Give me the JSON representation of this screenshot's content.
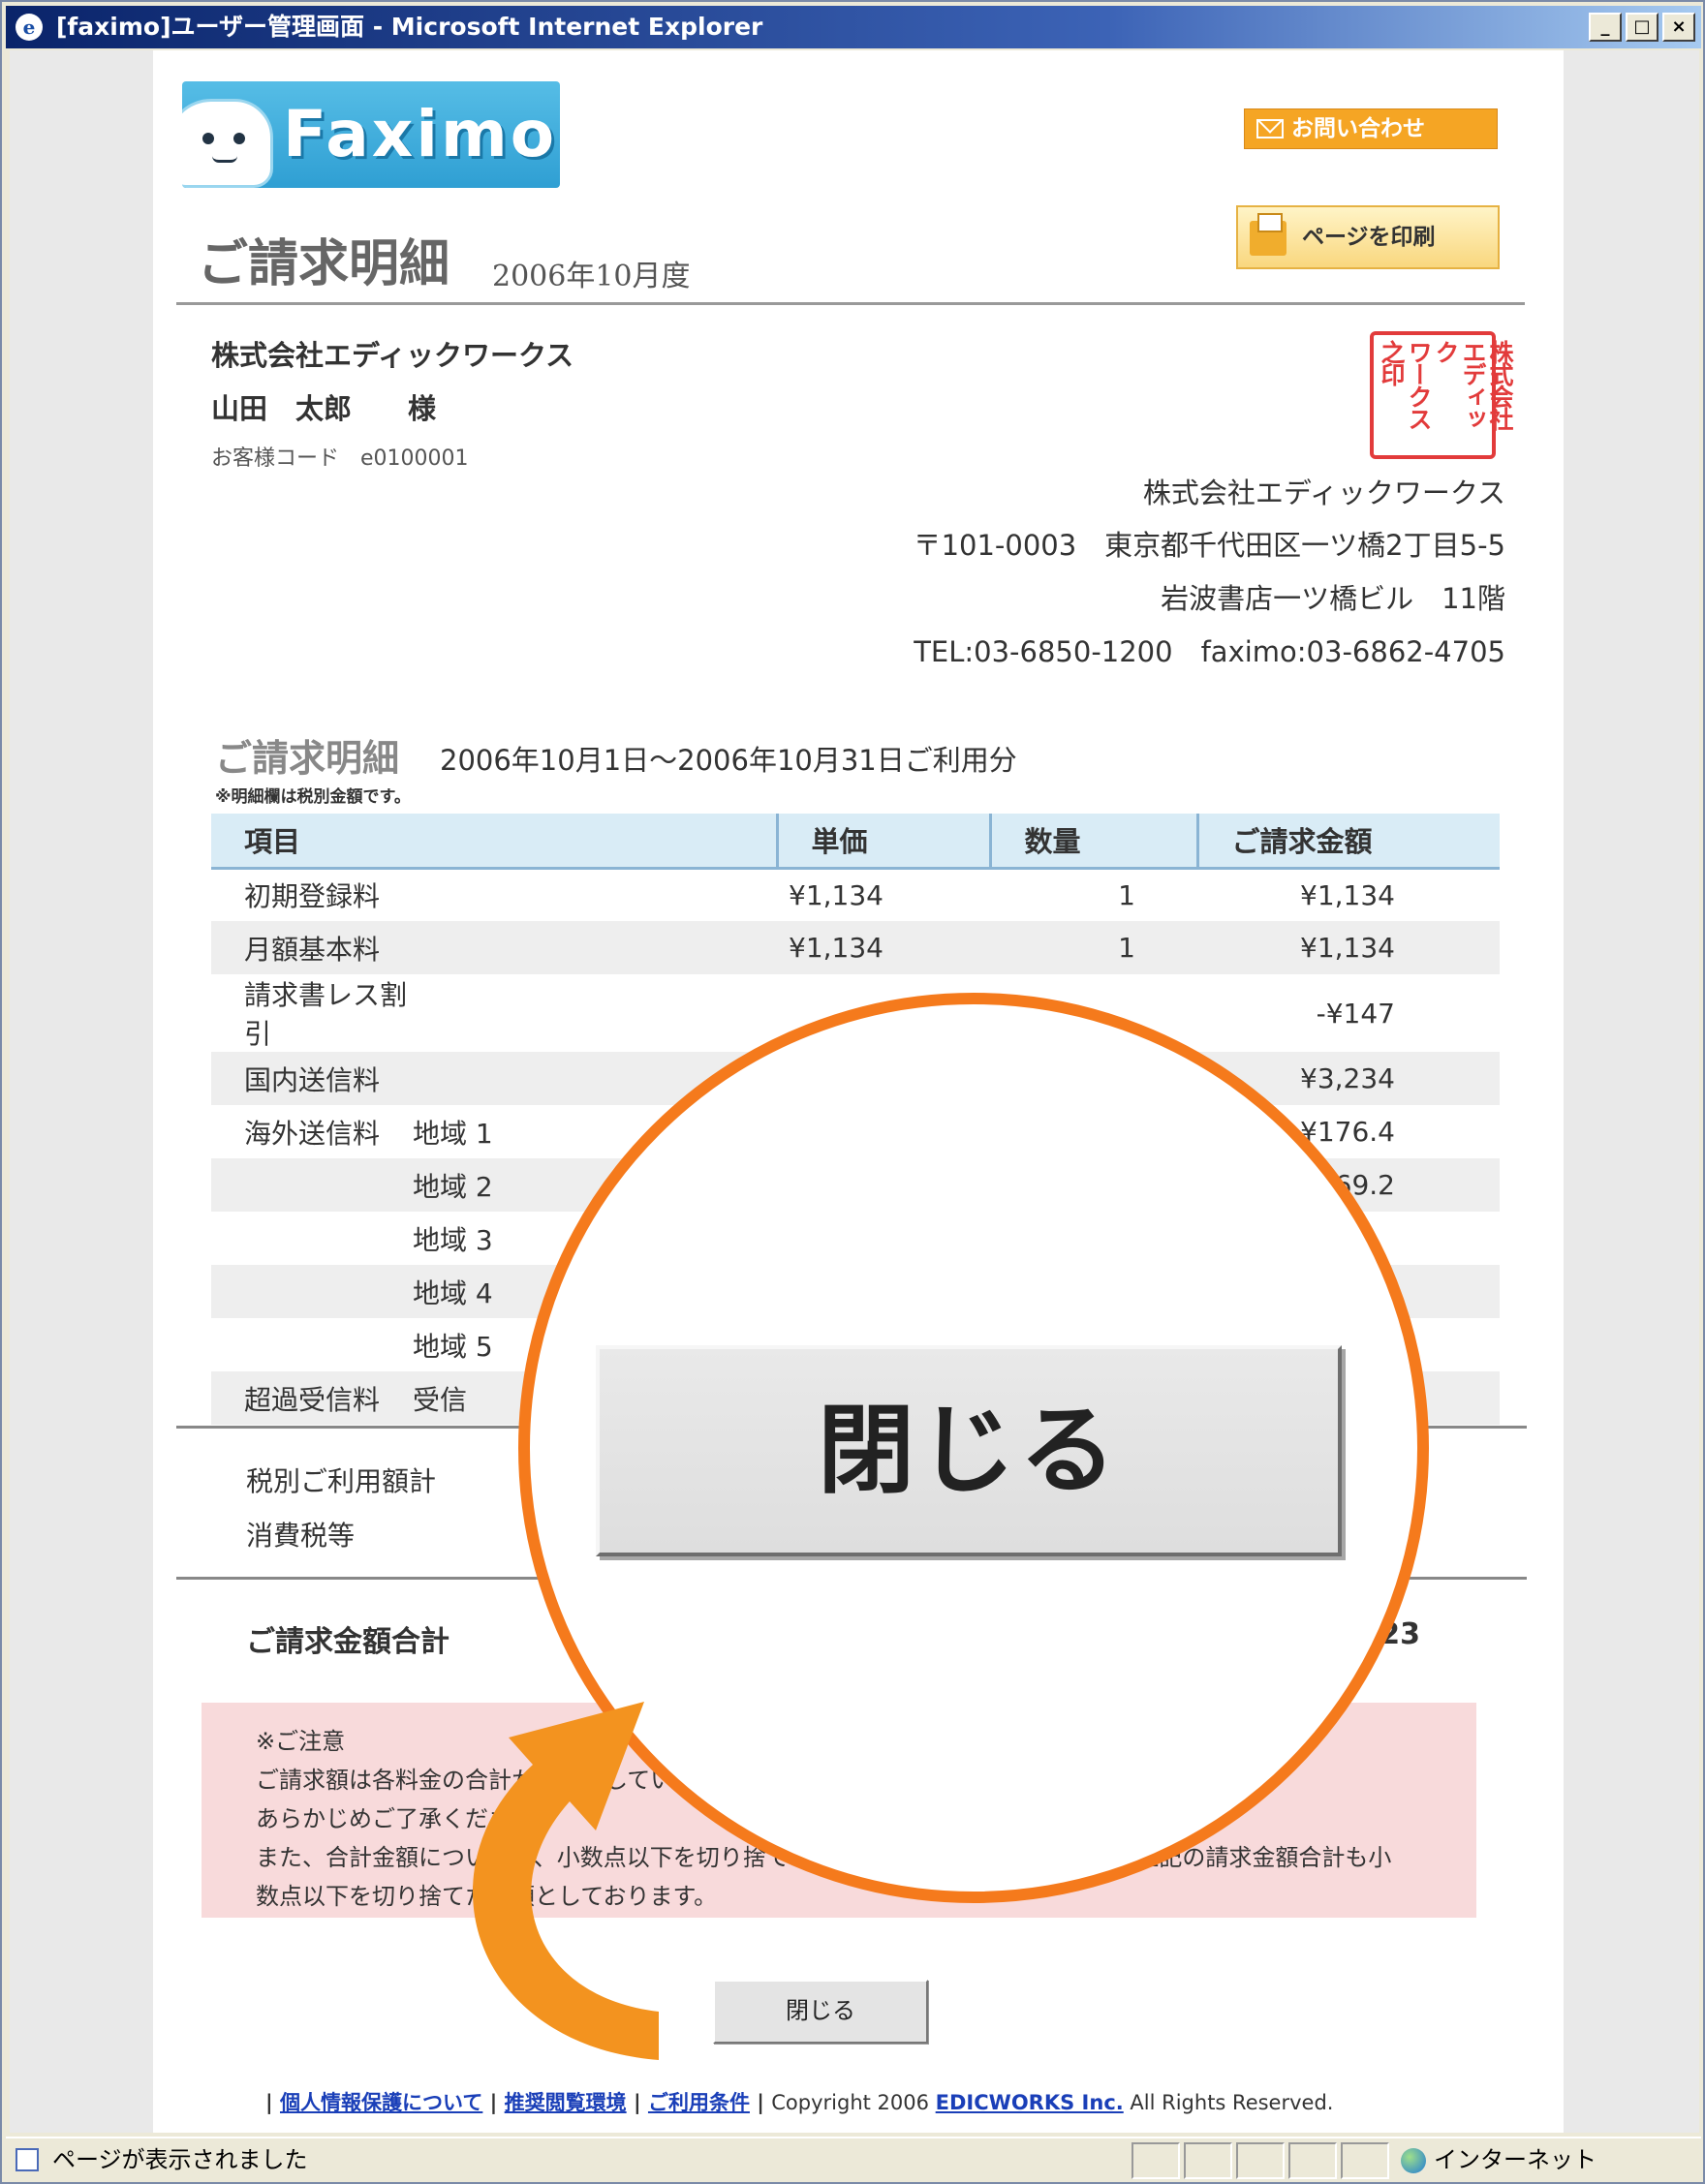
{
  "window": {
    "title": "[faximo]ユーザー管理画面 - Microsoft Internet Explorer",
    "controls": [
      "_",
      "□",
      "×"
    ]
  },
  "header": {
    "logo_text": "Faximo",
    "inquiry_button": "お問い合わせ",
    "print_button": "ページを印刷"
  },
  "invoice": {
    "title": "ご請求明細",
    "period": "2006年10月度",
    "customer_company": "株式会社エディックワークス",
    "customer_name": "山田　太郎　　様",
    "customer_code": "お客様コード　e0100001",
    "seal_columns": [
      "株式会社",
      "エディック",
      "ワークス之印"
    ],
    "issuer": {
      "company": "株式会社エディックワークス",
      "address1": "〒101-0003　東京都千代田区一ツ橋2丁目5-5",
      "address2": "岩波書店一ツ橋ビル　11階",
      "contact": "TEL:03-6850-1200　faximo:03-6862-4705"
    }
  },
  "detail": {
    "heading": "ご請求明細",
    "range": "2006年10月1日〜2006年10月31日ご利用分",
    "note": "※明細欄は税別金額です。",
    "columns": [
      "項目",
      "単価",
      "数量",
      "ご請求金額"
    ],
    "rows": [
      {
        "item": "初期登録料",
        "sub": "",
        "price": "¥1,134",
        "qty": "1",
        "amount": "¥1,134"
      },
      {
        "item": "月額基本料",
        "sub": "",
        "price": "¥1,134",
        "qty": "1",
        "amount": "¥1,134"
      },
      {
        "item": "請求書レス割引",
        "sub": "",
        "price": "",
        "qty": "",
        "amount": "-¥147"
      },
      {
        "item": "国内送信料",
        "sub": "",
        "price": "",
        "qty": "",
        "amount": "¥3,234"
      },
      {
        "item": "海外送信料",
        "sub": "地域 1",
        "price": "",
        "qty": "",
        "amount": "¥176.4"
      },
      {
        "item": "",
        "sub": "地域 2",
        "price": "",
        "qty": "",
        "amount": "¥69.2"
      },
      {
        "item": "",
        "sub": "地域 3",
        "price": "",
        "qty": "",
        "amount": ""
      },
      {
        "item": "",
        "sub": "地域 4",
        "price": "",
        "qty": "",
        "amount": ""
      },
      {
        "item": "",
        "sub": "地域 5",
        "price": "",
        "qty": "",
        "amount": ""
      },
      {
        "item": "超過受信料",
        "sub": "受信",
        "price": "",
        "qty": "",
        "amount": ""
      }
    ]
  },
  "summary": {
    "subtotal_label": "税別ご利用額計",
    "tax_label": "消費税等",
    "total_label": "ご請求金額合計",
    "total_value": "¥,923"
  },
  "notice": {
    "heading": "※ご注意",
    "line1": "ご請求額は各料金の合計から計算していますので、明細の合計とは異なります。",
    "line2": "あらかじめご了承ください。",
    "line3": "また、合計金額については、小数点以下を切り捨ててご請求いたします。そのため、上記の請求金額合計も小",
    "line4": "数点以下を切り捨てた金額としております。"
  },
  "close_button": "閉じる",
  "callout": {
    "zoom_label": "閉じる",
    "ring_color": "#f57a1c",
    "arrow_color": "#f3931f"
  },
  "footer": {
    "links": [
      "個人情報保護について",
      "推奨閲覧環境",
      "ご利用条件"
    ],
    "copyright_prefix": "Copyright 2006 ",
    "company_link": "EDICWORKS Inc.",
    "copyright_suffix": " All Rights Reserved."
  },
  "statusbar": {
    "message": "ページが表示されました",
    "zone": "インターネット"
  }
}
